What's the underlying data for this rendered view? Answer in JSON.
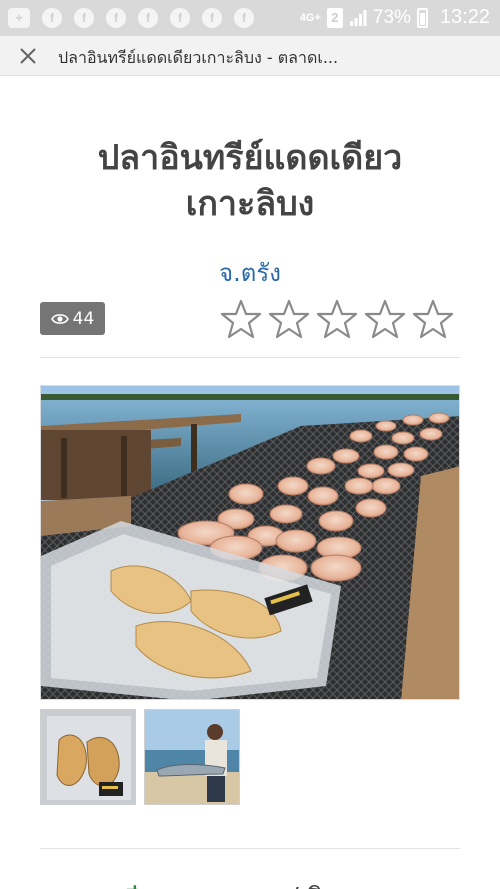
{
  "status_bar": {
    "network": "4G+",
    "sim": "2",
    "battery": "73%",
    "time": "13:22"
  },
  "title_bar": {
    "title": "ปลาอินทรีย์แดดเดียวเกาะลิบง - ตลาดเ..."
  },
  "product": {
    "title_line1": "ปลาอินทรีย์แดดเดียว",
    "title_line2": "เกาะลิบง",
    "province": "จ.ตรัง",
    "views": "44",
    "rating": 0,
    "rating_max": 5
  },
  "colors": {
    "province_link": "#2a6aa8",
    "badge_bg": "#757575",
    "price": "#2e8b3e"
  },
  "icons": [
    "close-icon",
    "eye-icon",
    "star-outline-icon"
  ]
}
